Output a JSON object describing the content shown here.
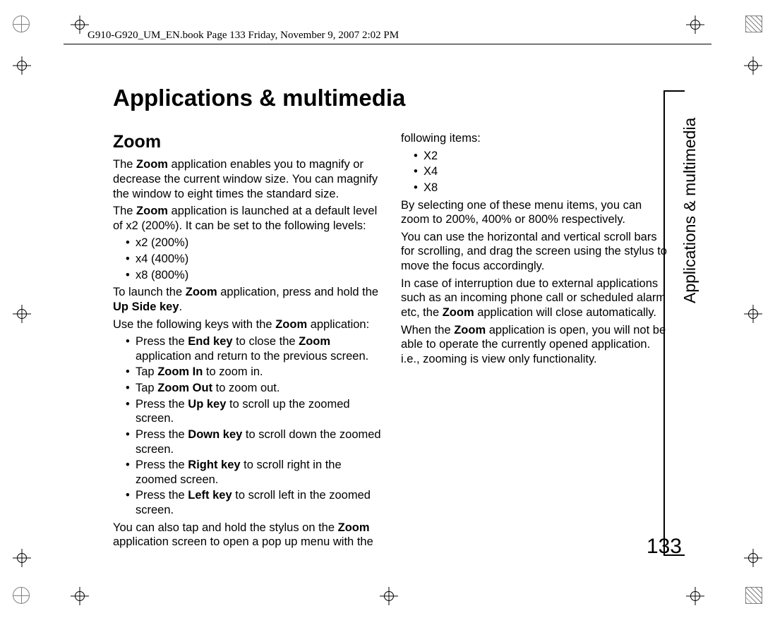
{
  "header": "G910-G920_UM_EN.book  Page 133  Friday, November 9, 2007  2:02 PM",
  "title": "Applications & multimedia",
  "side_label": "Applications & multimedia",
  "page_number": "133",
  "section_heading": "Zoom",
  "col": {
    "p1a": "The ",
    "p1b": "Zoom",
    "p1c": " application enables you to magnify or decrease the current window size. You can magnify the window to eight times the standard size.",
    "p2a": "The ",
    "p2b": "Zoom",
    "p2c": " application is launched at a default level of x2 (200%). It can be set to the following levels:",
    "levels": [
      "x2 (200%)",
      "x4 (400%)",
      "x8 (800%)"
    ],
    "p3a": "To launch the ",
    "p3b": "Zoom",
    "p3c": " application, press and hold the ",
    "p3d": "Up Side key",
    "p3e": ".",
    "p4a": "Use the following keys with the ",
    "p4b": "Zoom",
    "p4c": " application:",
    "keys": [
      {
        "pre": "Press the ",
        "bold": "End key",
        "mid": " to close the ",
        "bold2": "Zoom",
        "post": " application and return to the previous screen."
      },
      {
        "pre": "Tap ",
        "bold": "Zoom In",
        "mid": "",
        "bold2": "",
        "post": " to zoom in."
      },
      {
        "pre": "Tap ",
        "bold": "Zoom Out",
        "mid": "",
        "bold2": "",
        "post": " to zoom out."
      },
      {
        "pre": "Press the ",
        "bold": "Up key",
        "mid": "",
        "bold2": "",
        "post": " to scroll up the zoomed screen."
      },
      {
        "pre": "Press the ",
        "bold": "Down key",
        "mid": "",
        "bold2": "",
        "post": " to scroll down the zoomed screen."
      },
      {
        "pre": "Press the ",
        "bold": "Right key",
        "mid": "",
        "bold2": "",
        "post": " to scroll right in the zoomed screen."
      },
      {
        "pre": "Press the ",
        "bold": "Left key",
        "mid": "",
        "bold2": "",
        "post": " to scroll left in the zoomed screen."
      }
    ],
    "p5a": "You can also tap and hold the stylus on the ",
    "p5b": "Zoom",
    "p5c": " application screen to open a pop up menu with the following items:",
    "menu": [
      "X2",
      "X4",
      "X8"
    ],
    "p6": "By selecting one of these menu items, you can zoom to 200%, 400% or 800% respectively.",
    "p7": "You can use the horizontal and vertical scroll bars for scrolling, and drag the screen using the stylus to move the focus accordingly.",
    "p8a": "In case of interruption due to external applications such as an incoming phone call or scheduled alarm etc, the ",
    "p8b": "Zoom",
    "p8c": " application will close automatically.",
    "p9a": "When the ",
    "p9b": "Zoom",
    "p9c": " application is open, you will not be able to operate the currently opened application. i.e., zooming is view only functionality."
  }
}
